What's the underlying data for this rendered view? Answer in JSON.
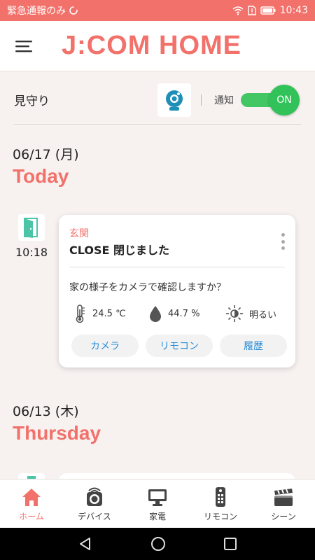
{
  "status_bar": {
    "left_text": "緊急通報のみ",
    "time": "10:43",
    "bg_color": "#f2716a"
  },
  "header": {
    "logo_text": "J:COM HOME",
    "accent_color": "#f2716a"
  },
  "watch": {
    "label": "見守り",
    "notify_label": "通知",
    "toggle_label": "ON",
    "toggle_color": "#32c25a"
  },
  "sections": [
    {
      "date": "06/17 (月)",
      "day": "Today",
      "events": [
        {
          "time": "10:18",
          "location": "玄関",
          "title": "CLOSE 閉じました",
          "question": "家の様子をカメラで確認しますか？",
          "temperature": "24.5 ℃",
          "humidity": "44.7 %",
          "brightness": "明るい",
          "buttons": [
            "カメラ",
            "リモコン",
            "履歴"
          ]
        }
      ]
    },
    {
      "date": "06/13 (木)",
      "day": "Thursday"
    }
  ],
  "tabs": [
    {
      "label": "ホーム",
      "icon": "home-icon",
      "active": true
    },
    {
      "label": "デバイス",
      "icon": "device-icon",
      "active": false
    },
    {
      "label": "家電",
      "icon": "monitor-icon",
      "active": false
    },
    {
      "label": "リモコン",
      "icon": "remote-icon",
      "active": false
    },
    {
      "label": "シーン",
      "icon": "clapper-icon",
      "active": false
    }
  ]
}
